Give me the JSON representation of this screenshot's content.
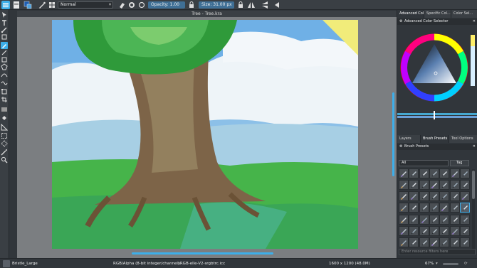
{
  "toolbar": {
    "blend_mode": "Normal",
    "opacity_label": "Opacity:",
    "opacity_value": "1.00",
    "size_label": "Size:",
    "size_value": "31.00 px"
  },
  "document": {
    "title": "Tree - Tree.kra"
  },
  "dock": {
    "top_tabs": [
      "Advanced Col...",
      "Specific Col...",
      "Color Sel..."
    ],
    "color_selector_title": "Advanced Color Selector",
    "mid_tabs": [
      "Layers",
      "Brush Presets",
      "Tool Options"
    ],
    "brush_presets_title": "Brush Presets",
    "filter_value": "All",
    "tag_label": "Tag",
    "filter_placeholder": "Enter resource filters here"
  },
  "status": {
    "brush_name": "Bristle_Large",
    "color_info": "RGB/Alpha (8-bit integer/channel)",
    "profile": "sRGB-elle-V2-srgbtrc.icc",
    "dimensions": "1600 x 1200 (48.0M)",
    "zoom": "67%"
  },
  "icons": [
    "menu-icon",
    "new-document-icon",
    "color-swatch-icon",
    "gradient-icon",
    "pattern-icon",
    "eraser-icon",
    "preserve-alpha-icon",
    "reset-icon",
    "mirror-horizontal-icon",
    "mirror-vertical-icon",
    "wrap-around-icon",
    "close-icon",
    "gear-icon"
  ],
  "colors": {
    "accent": "#3daee9",
    "field_active": "#3f6f95",
    "panel": "#31363b",
    "canvas_bg": "#7b7e81"
  }
}
